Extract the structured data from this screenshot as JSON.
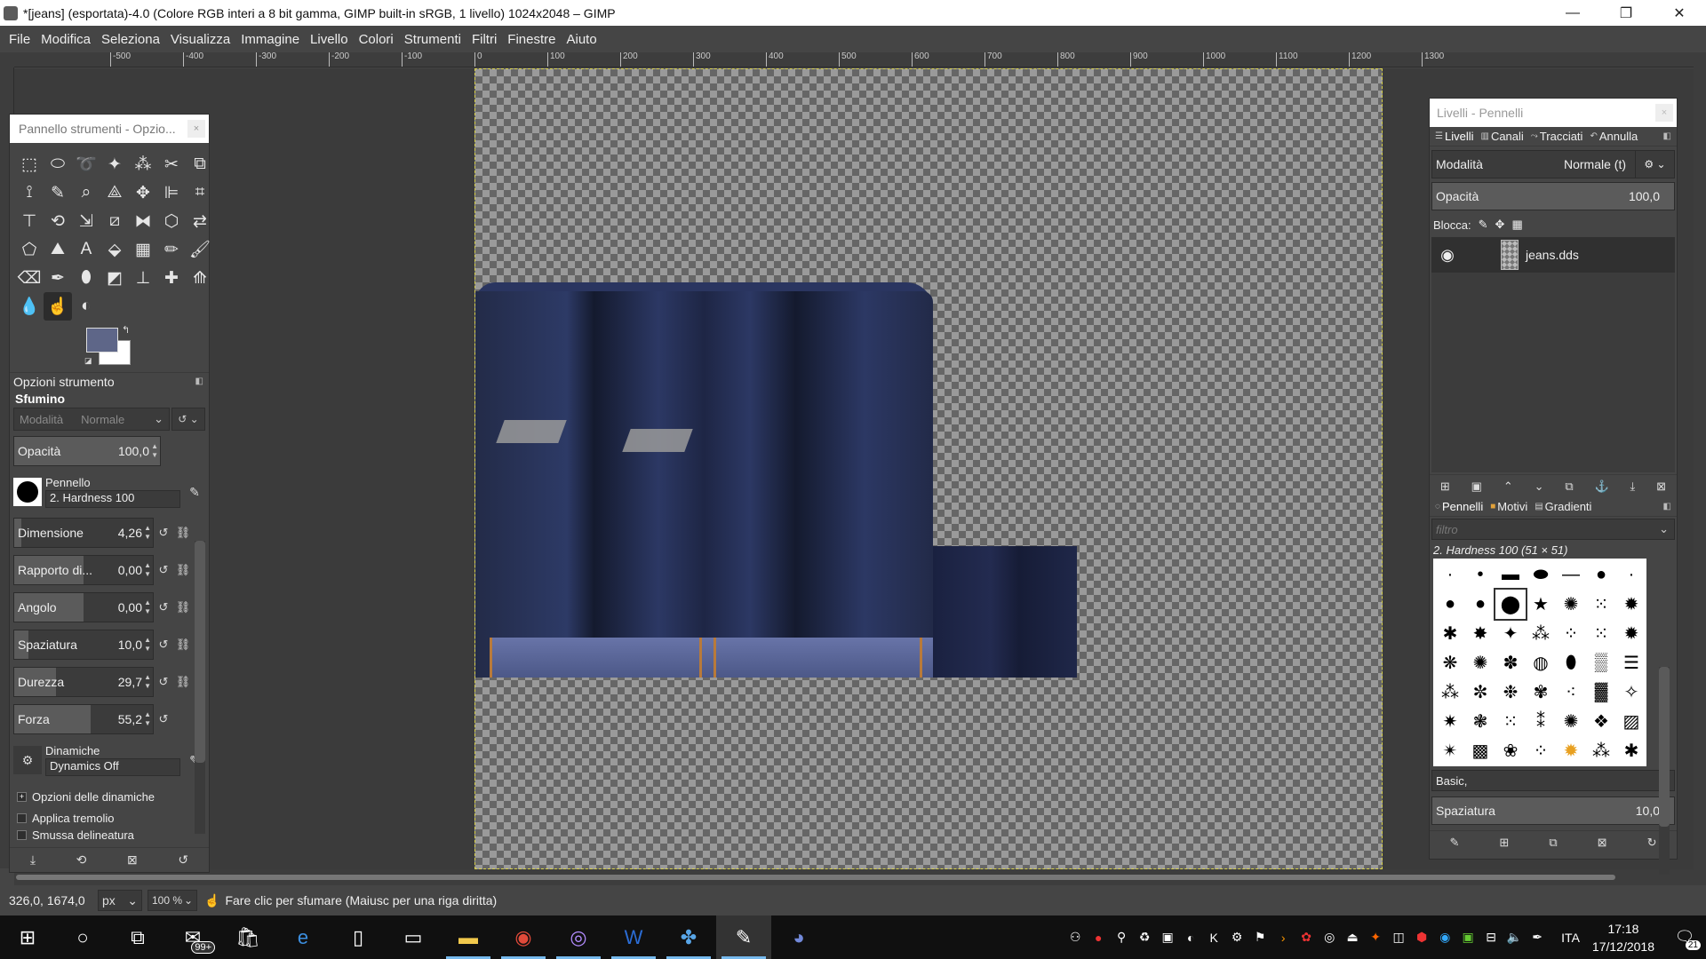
{
  "window": {
    "title": "*[jeans] (esportata)-4.0 (Colore RGB interi a 8 bit gamma, GIMP built-in sRGB, 1 livello) 1024x2048 – GIMP",
    "minimize": "—",
    "maximize": "❐",
    "close": "✕"
  },
  "menu": [
    "File",
    "Modifica",
    "Seleziona",
    "Visualizza",
    "Immagine",
    "Livello",
    "Colori",
    "Strumenti",
    "Filtri",
    "Finestre",
    "Aiuto"
  ],
  "ruler_ticks": [
    "-500",
    "-400",
    "-300",
    "-200",
    "-100",
    "0",
    "100",
    "200",
    "300",
    "400",
    "500",
    "600",
    "700",
    "800",
    "900",
    "1000",
    "1100",
    "1200",
    "1300"
  ],
  "toolbox": {
    "title": "Pannello strumenti - Opzio...",
    "close": "×",
    "options_header": "Opzioni strumento",
    "tool_name": "Sfumino",
    "mode_label": "Modalità",
    "mode_value": "Normale",
    "opacity_label": "Opacità",
    "opacity_value": "100,0",
    "brush_label": "Pennello",
    "brush_value": "2. Hardness 100",
    "params": [
      {
        "label": "Dimensione",
        "value": "4,26",
        "fill": 0.05
      },
      {
        "label": "Rapporto di...",
        "value": "0,00",
        "fill": 0.5
      },
      {
        "label": "Angolo",
        "value": "0,00",
        "fill": 0.5
      },
      {
        "label": "Spaziatura",
        "value": "10,0",
        "fill": 0.1
      },
      {
        "label": "Durezza",
        "value": "29,7",
        "fill": 0.3
      },
      {
        "label": "Forza",
        "value": "55,2",
        "fill": 0.55
      }
    ],
    "dynamics_label": "Dinamiche",
    "dynamics_value": "Dynamics Off",
    "checks": [
      {
        "label": "Opzioni delle dinamiche",
        "mark": "+"
      },
      {
        "label": "Applica tremolio",
        "mark": ""
      },
      {
        "label": "Smussa delineatura",
        "mark": ""
      }
    ]
  },
  "layers_dock": {
    "title": "Livelli - Pennelli",
    "close": "×",
    "tabs": [
      "Livelli",
      "Canali",
      "Tracciati",
      "Annulla"
    ],
    "mode_label": "Modalità",
    "mode_value": "Normale (t)",
    "opacity_label": "Opacità",
    "opacity_value": "100,0",
    "lock_label": "Blocca:",
    "layer_name": "jeans.dds"
  },
  "brushes_dock": {
    "tabs": [
      "Pennelli",
      "Motivi",
      "Gradienti"
    ],
    "filter_placeholder": "filtro",
    "selected_brush": "2. Hardness 100 (51 × 51)",
    "tag_value": "Basic,",
    "spacing_label": "Spaziatura",
    "spacing_value": "10,0"
  },
  "status": {
    "coords": "326,0, 1674,0",
    "unit": "px",
    "zoom": "100 %",
    "hint": "Fare clic per sfumare (Maiusc per una riga diritta)"
  },
  "taskbar": {
    "mail_badge": "99+",
    "lang": "ITA",
    "time": "17:18",
    "date": "17/12/2018",
    "notifications": "21"
  },
  "colors": {
    "foreground": "#5e6688",
    "background": "#ffffff",
    "selection_border": "#d9d24a"
  }
}
